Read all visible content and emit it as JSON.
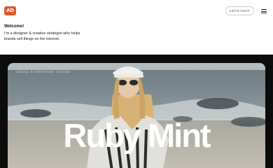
{
  "header": {
    "logo_text": "AD",
    "chat_label": "LET'S CHAT",
    "menu_icon": "hamburger-menu-icon"
  },
  "intro": {
    "heading": "Welcome!",
    "text": "I’m a designer & creative strategist who helps brands sell things on the internet."
  },
  "hero": {
    "tag": "BRAND  STOREFRONT  DESIGN",
    "title": "Ruby Mint"
  },
  "colors": {
    "brand": "#e4572e",
    "dark_band": "#0c0c0c",
    "hero_text": "#ffffff"
  }
}
